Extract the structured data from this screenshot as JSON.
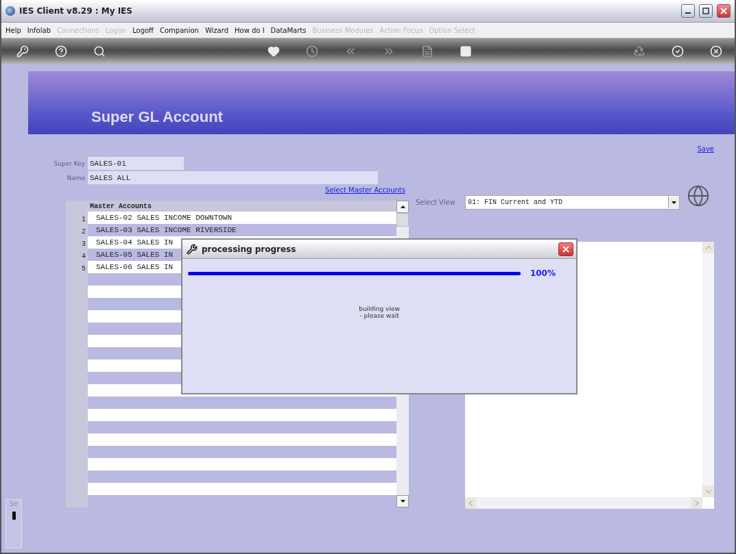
{
  "window": {
    "title": "IES Client v8.29 : My IES"
  },
  "menu": [
    {
      "label": "Help",
      "disabled": false
    },
    {
      "label": "Infolab",
      "disabled": false
    },
    {
      "label": "Connections",
      "disabled": true
    },
    {
      "label": "Logon",
      "disabled": true
    },
    {
      "label": "Logoff",
      "disabled": false
    },
    {
      "label": "Companion",
      "disabled": false
    },
    {
      "label": "Wizard",
      "disabled": false
    },
    {
      "label": "How do I",
      "disabled": false
    },
    {
      "label": "DataMarts",
      "disabled": false
    },
    {
      "label": "Business Modules",
      "disabled": true
    },
    {
      "label": "Action Focus",
      "disabled": true
    },
    {
      "label": "Option Select",
      "disabled": true
    }
  ],
  "toolbar": [
    {
      "kind": "key",
      "disabled": false
    },
    {
      "kind": "help",
      "disabled": false
    },
    {
      "kind": "search",
      "disabled": false
    },
    {
      "kind": "spacer"
    },
    {
      "kind": "heart",
      "disabled": false
    },
    {
      "kind": "clock",
      "disabled": true
    },
    {
      "kind": "back",
      "disabled": true
    },
    {
      "kind": "forward",
      "disabled": true
    },
    {
      "kind": "doc",
      "disabled": true
    },
    {
      "kind": "square",
      "disabled": false
    },
    {
      "kind": "spacer"
    },
    {
      "kind": "recycle",
      "disabled": true
    },
    {
      "kind": "check",
      "disabled": false
    },
    {
      "kind": "close",
      "disabled": false
    }
  ],
  "banner": {
    "title": "Super GL Account"
  },
  "save_link": "Save",
  "form": {
    "super_key": {
      "label": "Super Key",
      "value": "SALES-01"
    },
    "name": {
      "label": "Name",
      "value": "SALES ALL"
    }
  },
  "select_master_link": "Select Master Accounts",
  "table": {
    "header": "Master Accounts",
    "rows": [
      {
        "number": "1",
        "account": "SALES-02 SALES INCOME DOWNTOWN"
      },
      {
        "number": "2",
        "account": "SALES-03 SALES INCOME RIVERSIDE"
      },
      {
        "number": "3",
        "account": "SALES-04 SALES IN"
      },
      {
        "number": "4",
        "account": "SALES-05 SALES IN"
      },
      {
        "number": "5",
        "account": "SALES-06 SALES IN"
      }
    ]
  },
  "view": {
    "label": "Select View",
    "value": "01: FIN Current and YTD"
  },
  "side_tab": {
    "label": "Se"
  },
  "dialog": {
    "title": "processing progress",
    "level": 1,
    "percent": "100%",
    "message": [
      "building view",
      "- please wait"
    ]
  }
}
